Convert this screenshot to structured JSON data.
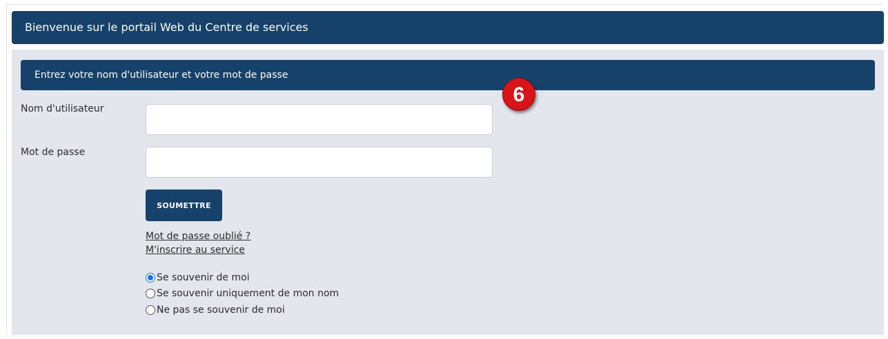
{
  "header": {
    "title": "Bienvenue sur le portail Web du Centre de services"
  },
  "login": {
    "panel_title": "Entrez votre nom d'utilisateur et votre mot de passe",
    "username_label": "Nom d'utilisateur",
    "username_value": "",
    "password_label": "Mot de passe",
    "password_value": "",
    "submit_label": "SOUMETTRE",
    "forgot_link": "Mot de passe oublié ?",
    "register_link": "M'inscrire au service",
    "remember_options": [
      {
        "label": "Se souvenir de moi",
        "checked": true
      },
      {
        "label": "Se souvenir uniquement de mon nom",
        "checked": false
      },
      {
        "label": "Ne pas se souvenir de moi",
        "checked": false
      }
    ]
  },
  "annotation": {
    "step_number": "6",
    "color": "#d8141b"
  },
  "colors": {
    "header_bg": "#16416a",
    "panel_bg": "#e3e6ed"
  }
}
